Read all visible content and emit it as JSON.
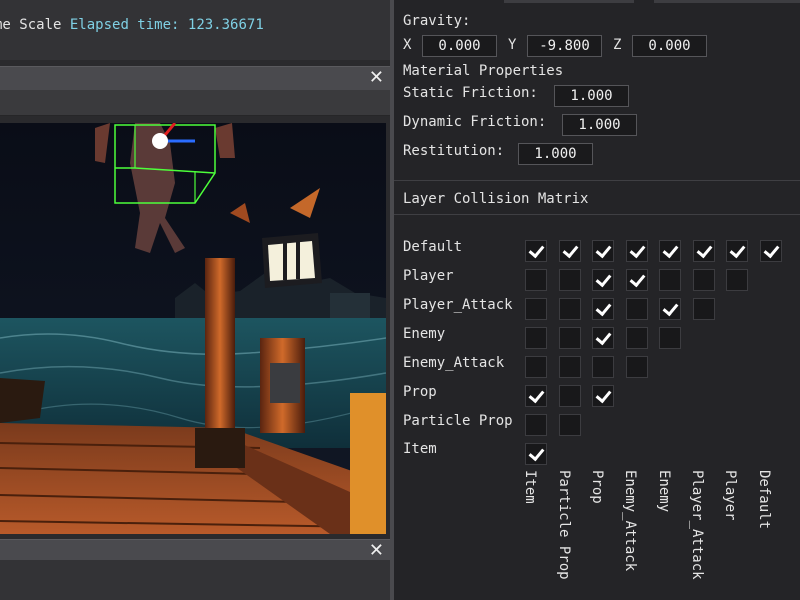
{
  "topbar": {
    "left_text": "me Scale",
    "elapsed_label": "Elapsed time:",
    "elapsed_value": "123.36671"
  },
  "scene_panel": {
    "close_glyph": "✕"
  },
  "bottom_panel": {
    "close_glyph": "✕"
  },
  "physics": {
    "gravity_label": "Gravity:",
    "x_label": "X",
    "x_value": "0.000",
    "y_label": "Y",
    "y_value": "-9.800",
    "z_label": "Z",
    "z_value": "0.000",
    "material_label": "Material Properties",
    "static_friction_label": "Static Friction:",
    "static_friction_value": "1.000",
    "dynamic_friction_label": "Dynamic Friction:",
    "dynamic_friction_value": "1.000",
    "restitution_label": "Restitution:",
    "restitution_value": "1.000"
  },
  "matrix": {
    "title": "Layer Collision Matrix",
    "rows": [
      "Default",
      "Player",
      "Player_Attack",
      "Enemy",
      "Enemy_Attack",
      "Prop",
      "Particle Prop",
      "Item"
    ],
    "columns": [
      "Item",
      "Particle Prop",
      "Prop",
      "Enemy_Attack",
      "Enemy",
      "Player_Attack",
      "Player",
      "Default"
    ],
    "checked": [
      [
        true,
        true,
        true,
        true,
        true,
        true,
        true,
        true
      ],
      [
        false,
        false,
        true,
        true,
        false,
        false,
        false
      ],
      [
        false,
        false,
        true,
        false,
        true,
        false
      ],
      [
        false,
        false,
        true,
        false,
        false
      ],
      [
        false,
        false,
        false,
        false
      ],
      [
        true,
        false,
        true
      ],
      [
        false,
        false
      ],
      [
        true
      ]
    ]
  }
}
